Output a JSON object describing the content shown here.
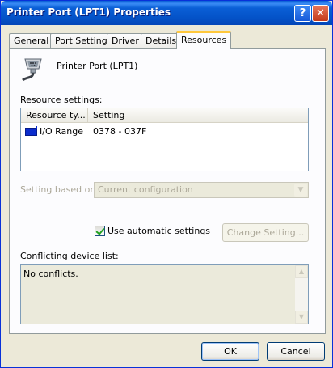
{
  "window": {
    "title": "Printer Port (LPT1) Properties"
  },
  "titlebar": {
    "help_glyph": "?",
    "close_glyph": "✕"
  },
  "tabs": [
    {
      "label": "General"
    },
    {
      "label": "Port Settings"
    },
    {
      "label": "Driver"
    },
    {
      "label": "Details"
    },
    {
      "label": "Resources"
    }
  ],
  "active_tab": "Resources",
  "device": {
    "name": "Printer Port (LPT1)",
    "icon": "port-connector-icon"
  },
  "resource_settings": {
    "label": "Resource settings:",
    "columns": [
      "Resource ty...",
      "Setting"
    ],
    "rows": [
      {
        "type": "I/O Range",
        "setting": "0378 - 037F",
        "icon": "io-range-icon"
      }
    ]
  },
  "setting_based_on": {
    "label": "Setting based on:",
    "value": "Current configuration"
  },
  "auto_settings": {
    "label": "Use automatic settings",
    "checked": true
  },
  "change_setting_button": "Change Setting...",
  "conflicts": {
    "label": "Conflicting device list:",
    "text": "No conflicts."
  },
  "buttons": {
    "ok": "OK",
    "cancel": "Cancel"
  },
  "colors": {
    "titlebar": "#0453c8",
    "dialog_bg": "#ece9d8",
    "panel_bg": "#fcfcfe",
    "active_tab_accent": "#ffc83c",
    "checkmark": "#21a121",
    "disabled_text": "#aca899"
  }
}
